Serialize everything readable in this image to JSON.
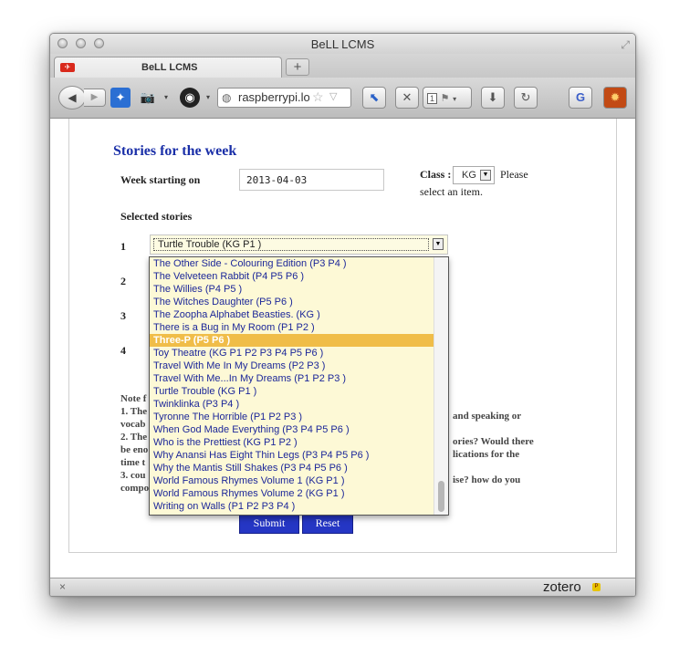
{
  "window": {
    "title": "BeLL LCMS"
  },
  "tab": {
    "title": "BeLL LCMS",
    "new_tab_label": "+"
  },
  "toolbar": {
    "url": "raspberrypi.lo",
    "tab_count": "1"
  },
  "page": {
    "heading": "Stories for the week",
    "week_label": "Week starting on",
    "week_value": "2013-04-03",
    "class_label": "Class :",
    "class_value": "KG",
    "class_hint_1": "Please",
    "class_hint_2": "select an item.",
    "selected_label": "Selected stories",
    "rows": [
      "1",
      "2",
      "3",
      "4"
    ],
    "select1_value": "Turtle Trouble (KG P1 )",
    "submit_label": "Submit",
    "reset_label": "Reset",
    "note_lines": [
      "Note f",
      "1. The",
      "vocab",
      "2. The",
      "be eno",
      "time t",
      "3. cou",
      "compo"
    ],
    "note_right": [
      "and speaking or",
      "ories? Would there",
      "lications for the",
      "ise? how do you"
    ]
  },
  "dropdown": {
    "selected_index": 6,
    "items": [
      "The Other Side - Colouring Edition (P3 P4 )",
      "The Velveteen Rabbit (P4 P5 P6 )",
      "The Willies (P4 P5 )",
      "The Witches Daughter (P5 P6 )",
      "The Zoopha Alphabet Beasties. (KG )",
      "There is a Bug in My Room (P1 P2 )",
      "Three-P (P5 P6 )",
      "Toy Theatre (KG P1 P2 P3 P4 P5 P6 )",
      "Travel With Me In My Dreams (P2 P3 )",
      "Travel With Me...In My Dreams (P1 P2 P3 )",
      "Turtle Trouble (KG P1 )",
      "Twinklinka (P3 P4 )",
      "Tyronne The Horrible (P1 P2 P3 )",
      "When God Made Everything (P3 P4 P5 P6 )",
      "Who is the Prettiest (KG P1 P2 )",
      "Why Anansi Has Eight Thin Legs (P3 P4 P5 P6 )",
      "Why the Mantis Still Shakes (P3 P4 P5 P6 )",
      "World Famous Rhymes Volume 1 (KG P1 )",
      "World Famous Rhymes Volume 2 (KG P1 )",
      "Writing on Walls (P1 P2 P3 P4 )"
    ]
  },
  "statusbar": {
    "close_label": "×",
    "zotero_label": "zotero",
    "zotero_badge": "P"
  }
}
